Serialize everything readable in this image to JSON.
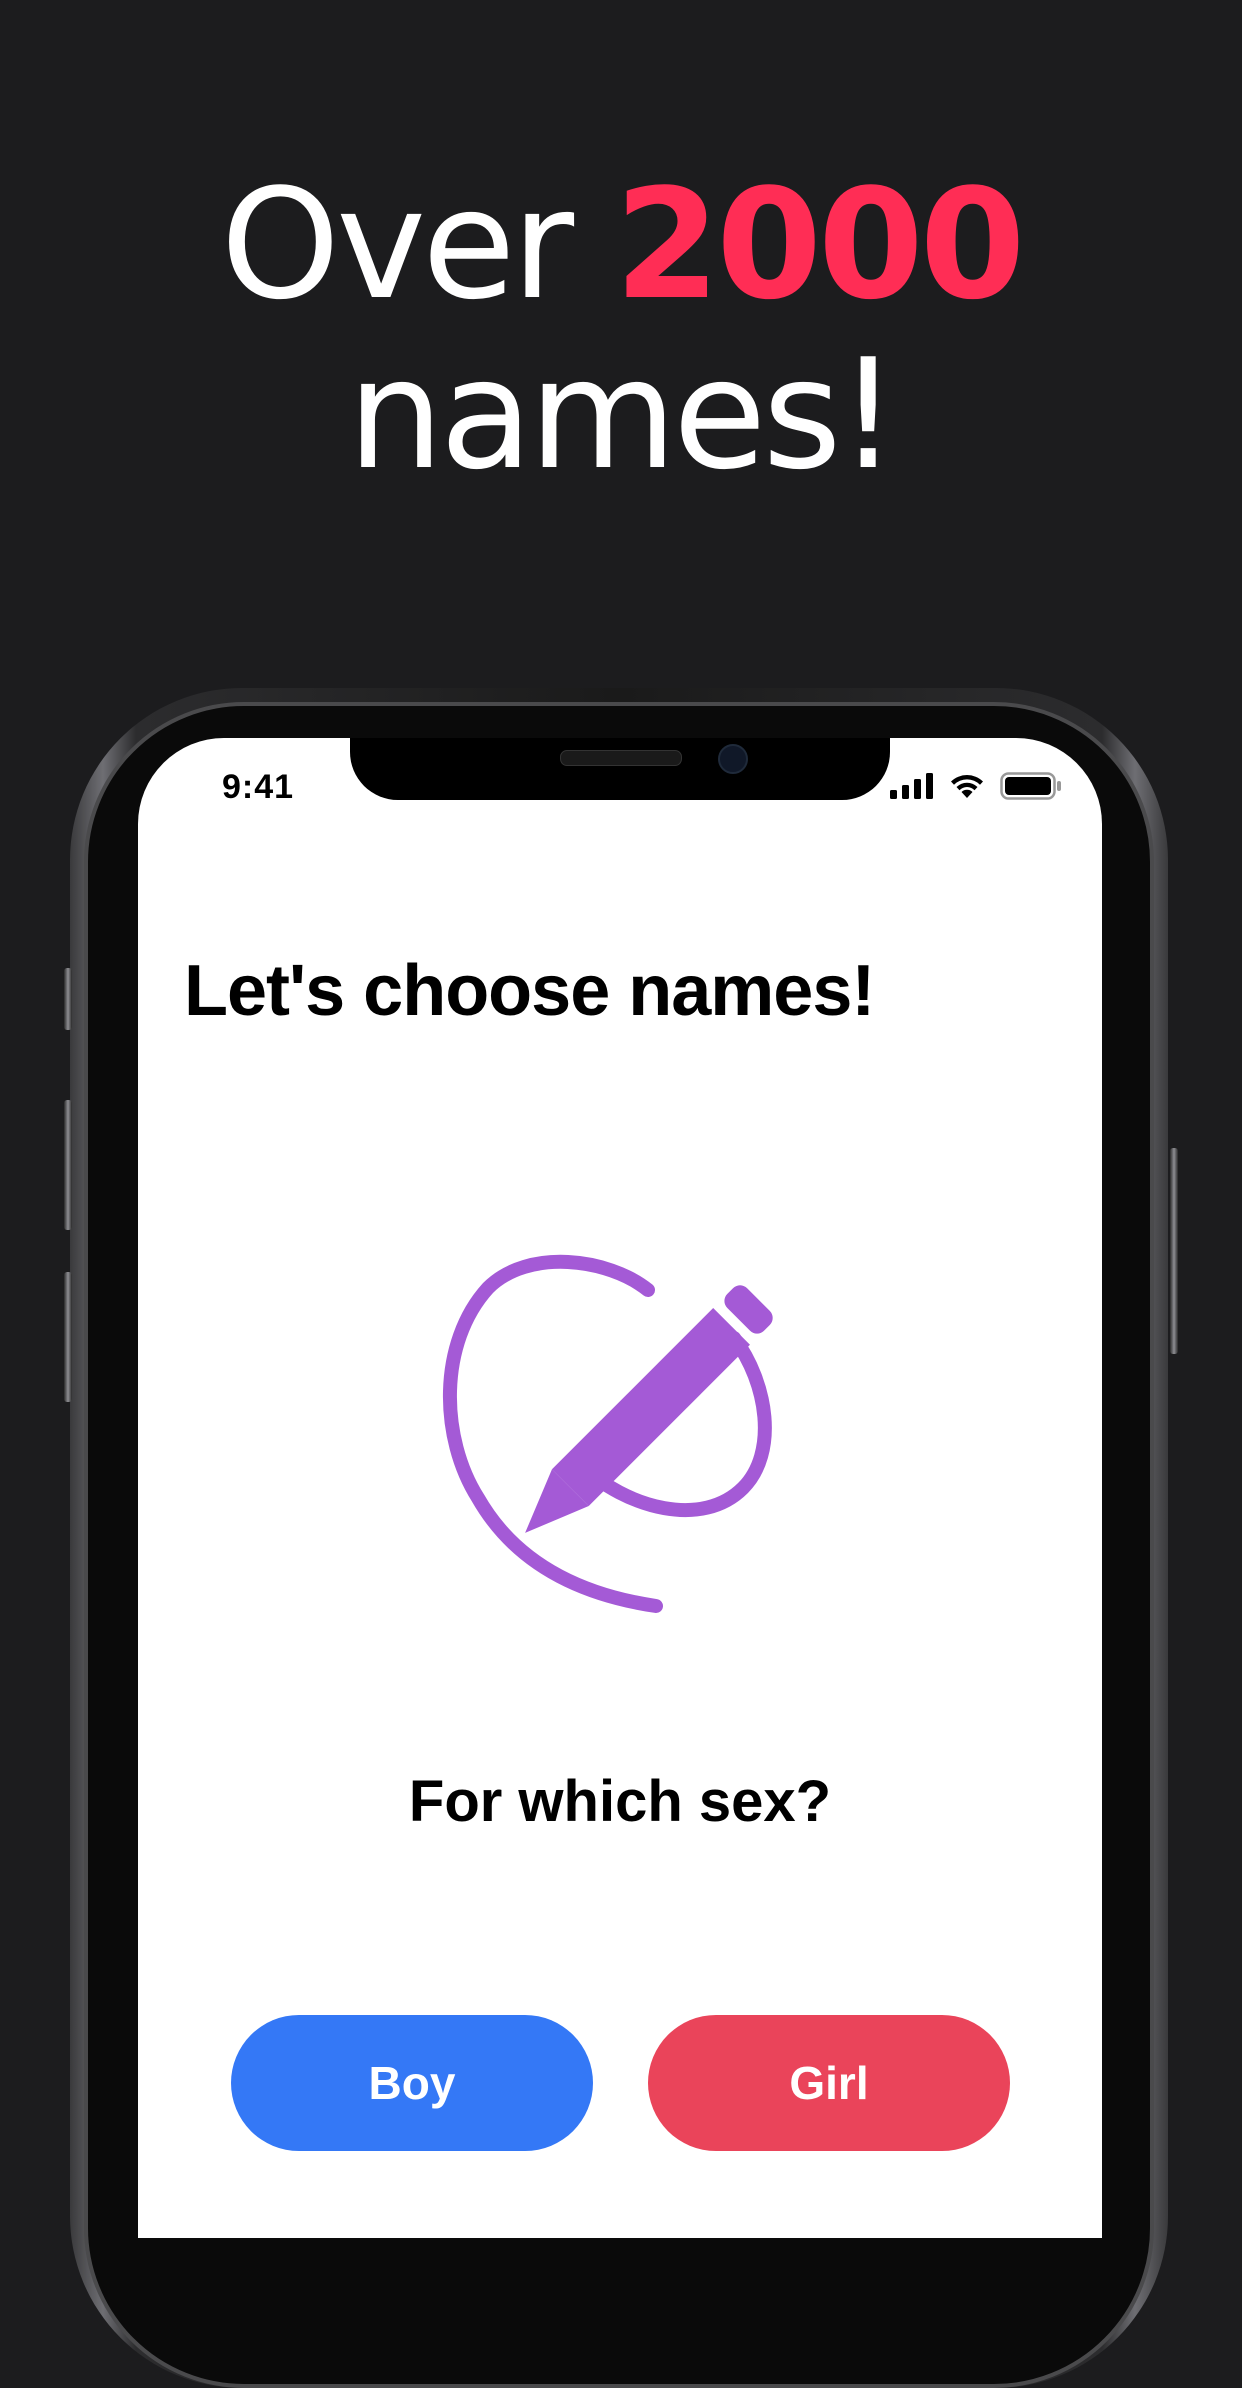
{
  "headline": {
    "line1_prefix": "Over ",
    "line1_accent": "2000",
    "line2": "names!",
    "accent_color": "#ff2d55"
  },
  "status_bar": {
    "time": "9:41",
    "icons": [
      "cellular-signal-icon",
      "wifi-icon",
      "battery-icon"
    ]
  },
  "screen": {
    "title": "Let's choose names!",
    "illustration": "pencil-circle-icon",
    "illustration_color": "#a45ad6",
    "question": "For which sex?"
  },
  "buttons": {
    "boy": {
      "label": "Boy",
      "color": "#3478f6"
    },
    "girl": {
      "label": "Girl",
      "color": "#ea445a"
    }
  }
}
